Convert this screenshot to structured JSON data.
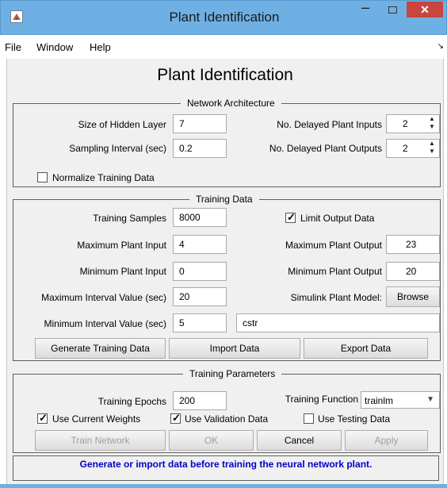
{
  "window": {
    "title": "Plant Identification"
  },
  "menu": [
    "File",
    "Window",
    "Help"
  ],
  "heading": "Plant Identification",
  "network_architecture": {
    "title": "Network Architecture",
    "hidden_layer_label": "Size of Hidden Layer",
    "hidden_layer_value": "7",
    "sampling_label": "Sampling Interval (sec)",
    "sampling_value": "0.2",
    "delayed_inputs_label": "No. Delayed Plant Inputs",
    "delayed_inputs_value": "2",
    "delayed_outputs_label": "No. Delayed Plant Outputs",
    "delayed_outputs_value": "2",
    "normalize_label": "Normalize Training Data",
    "normalize_checked": false
  },
  "training_data": {
    "title": "Training Data",
    "samples_label": "Training Samples",
    "samples_value": "8000",
    "limit_output_label": "Limit Output Data",
    "limit_output_checked": true,
    "max_input_label": "Maximum Plant Input",
    "max_input_value": "4",
    "max_output_label": "Maximum Plant Output",
    "max_output_value": "23",
    "min_input_label": "Minimum Plant Input",
    "min_input_value": "0",
    "min_output_label": "Minimum Plant Output",
    "min_output_value": "20",
    "max_interval_label": "Maximum Interval Value (sec)",
    "max_interval_value": "20",
    "simulink_label": "Simulink Plant Model:",
    "browse_label": "Browse",
    "min_interval_label": "Minimum Interval Value (sec)",
    "min_interval_value": "5",
    "model_name": "cstr",
    "generate_label": "Generate Training Data",
    "import_label": "Import Data",
    "export_label": "Export Data"
  },
  "training_parameters": {
    "title": "Training Parameters",
    "epochs_label": "Training Epochs",
    "epochs_value": "200",
    "function_label": "Training Function",
    "function_value": "trainlm",
    "use_current_weights_label": "Use Current Weights",
    "use_current_weights_checked": true,
    "use_validation_label": "Use Validation Data",
    "use_validation_checked": true,
    "use_testing_label": "Use Testing Data",
    "use_testing_checked": false
  },
  "buttons": {
    "train": "Train Network",
    "ok": "OK",
    "cancel": "Cancel",
    "apply": "Apply"
  },
  "status": "Generate or import data before training the neural network plant.",
  "colors": {
    "titlebar": "#6fb0e4",
    "close": "#c7463d",
    "status_text": "#0000c8"
  }
}
